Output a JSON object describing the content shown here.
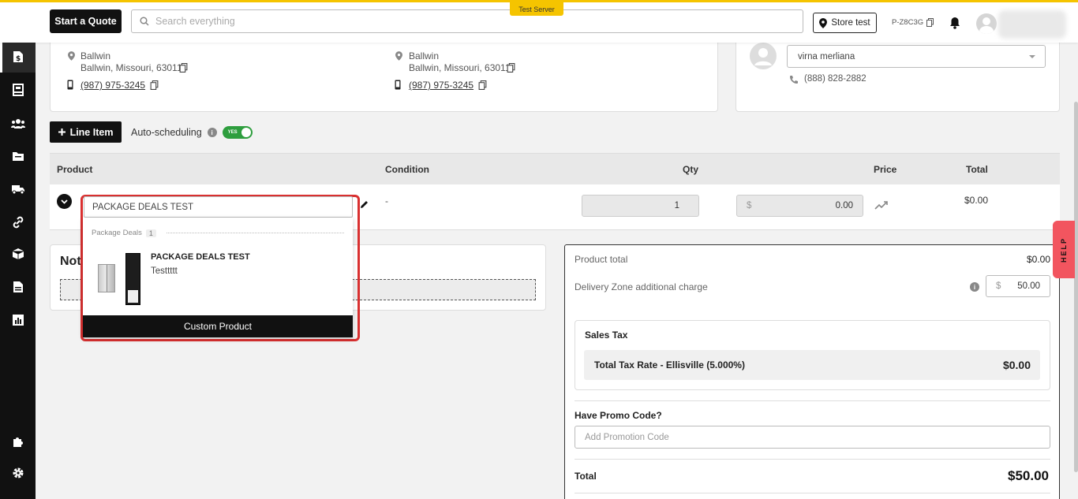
{
  "header": {
    "start_quote": "Start a Quote",
    "search_placeholder": "Search everything",
    "server_badge": "Test Server",
    "store_label": "Store test",
    "account_code": "P-Z8C3G"
  },
  "addresses": {
    "left": {
      "city": "Ballwin",
      "full": "Ballwin, Missouri, 63011",
      "phone": "(987) 975-3245"
    },
    "right": {
      "city": "Ballwin",
      "full": "Ballwin, Missouri, 63011",
      "phone": "(987) 975-3245"
    }
  },
  "salesperson": {
    "selected": "virna merliana",
    "phone": "(888) 828-2882"
  },
  "line_items": {
    "add_button": "Line Item",
    "autoscheduling_label": "Auto-scheduling",
    "toggle_text": "YES",
    "columns": {
      "product": "Product",
      "condition": "Condition",
      "qty": "Qty",
      "price": "Price",
      "total": "Total"
    },
    "row": {
      "product_value": "PACKAGE DEALS TEST",
      "condition": "-",
      "qty": "1",
      "currency": "$",
      "price": "0.00",
      "total": "$0.00"
    }
  },
  "dropdown": {
    "group_label": "Package Deals",
    "group_count": "1",
    "item_name": "PACKAGE DEALS TEST",
    "item_sub": "Testtttt",
    "custom_product": "Custom Product"
  },
  "notes": {
    "title": "Not"
  },
  "summary": {
    "product_total_label": "Product total",
    "product_total_value": "$0.00",
    "zone_label": "Delivery Zone additional charge",
    "zone_currency": "$",
    "zone_value": "50.00",
    "sales_tax_title": "Sales Tax",
    "tax_rate_label": "Total Tax Rate - Ellisville (5.000%)",
    "tax_rate_value": "$0.00",
    "promo_label": "Have Promo Code?",
    "promo_placeholder": "Add Promotion Code",
    "total_label": "Total",
    "total_value": "$50.00"
  },
  "help": {
    "label": "HELP"
  }
}
